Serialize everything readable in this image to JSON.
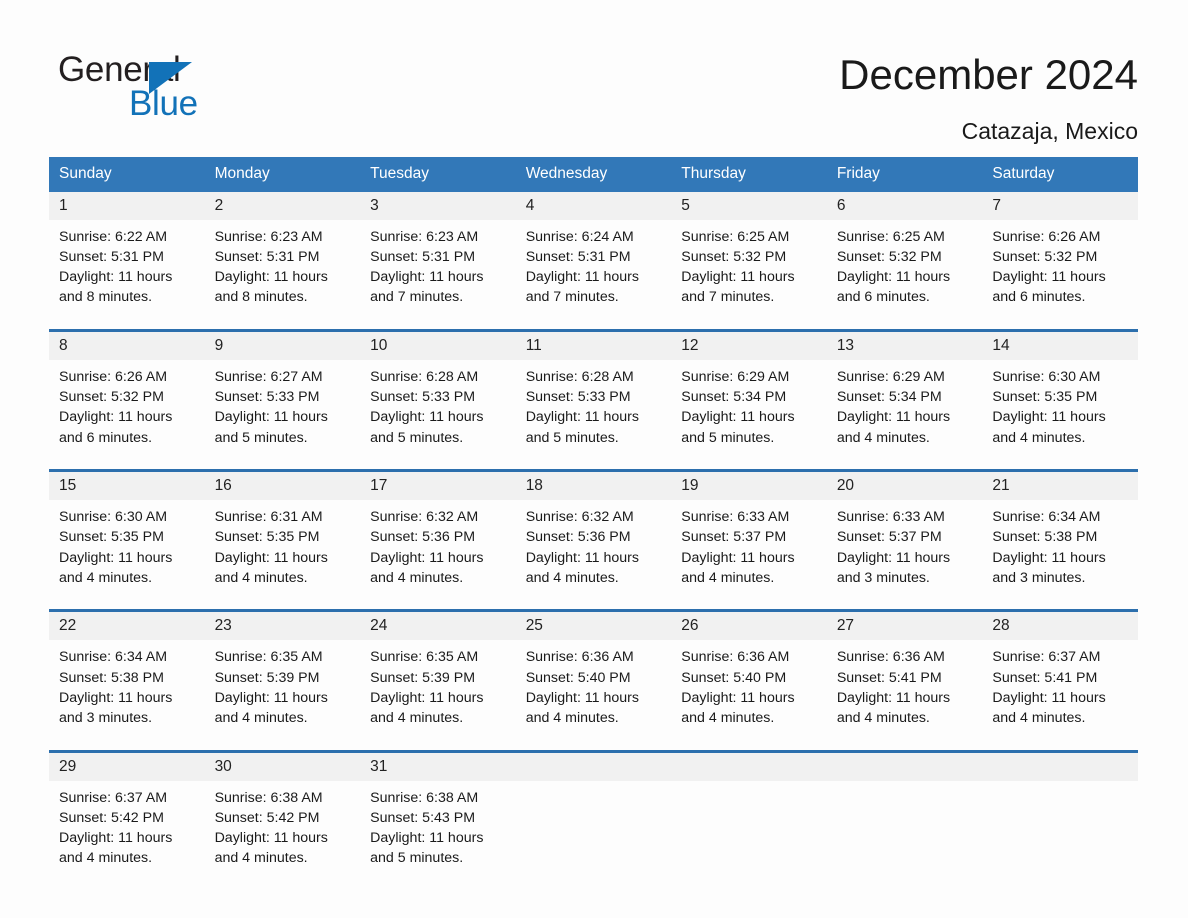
{
  "brand": {
    "name_part1": "General",
    "name_part2": "Blue",
    "accent_color": "#1272b8"
  },
  "header": {
    "title": "December 2024",
    "location": "Catazaja, Mexico"
  },
  "theme": {
    "header_blue": "#3278b8",
    "divider_blue": "#2c6fad",
    "daynum_bg": "#f1f1f1",
    "page_bg": "#fdfdfd"
  },
  "weekdays": [
    "Sunday",
    "Monday",
    "Tuesday",
    "Wednesday",
    "Thursday",
    "Friday",
    "Saturday"
  ],
  "weeks": [
    {
      "days": [
        {
          "date": "1",
          "sunrise": "Sunrise: 6:22 AM",
          "sunset": "Sunset: 5:31 PM",
          "daylight1": "Daylight: 11 hours",
          "daylight2": "and 8 minutes."
        },
        {
          "date": "2",
          "sunrise": "Sunrise: 6:23 AM",
          "sunset": "Sunset: 5:31 PM",
          "daylight1": "Daylight: 11 hours",
          "daylight2": "and 8 minutes."
        },
        {
          "date": "3",
          "sunrise": "Sunrise: 6:23 AM",
          "sunset": "Sunset: 5:31 PM",
          "daylight1": "Daylight: 11 hours",
          "daylight2": "and 7 minutes."
        },
        {
          "date": "4",
          "sunrise": "Sunrise: 6:24 AM",
          "sunset": "Sunset: 5:31 PM",
          "daylight1": "Daylight: 11 hours",
          "daylight2": "and 7 minutes."
        },
        {
          "date": "5",
          "sunrise": "Sunrise: 6:25 AM",
          "sunset": "Sunset: 5:32 PM",
          "daylight1": "Daylight: 11 hours",
          "daylight2": "and 7 minutes."
        },
        {
          "date": "6",
          "sunrise": "Sunrise: 6:25 AM",
          "sunset": "Sunset: 5:32 PM",
          "daylight1": "Daylight: 11 hours",
          "daylight2": "and 6 minutes."
        },
        {
          "date": "7",
          "sunrise": "Sunrise: 6:26 AM",
          "sunset": "Sunset: 5:32 PM",
          "daylight1": "Daylight: 11 hours",
          "daylight2": "and 6 minutes."
        }
      ]
    },
    {
      "days": [
        {
          "date": "8",
          "sunrise": "Sunrise: 6:26 AM",
          "sunset": "Sunset: 5:32 PM",
          "daylight1": "Daylight: 11 hours",
          "daylight2": "and 6 minutes."
        },
        {
          "date": "9",
          "sunrise": "Sunrise: 6:27 AM",
          "sunset": "Sunset: 5:33 PM",
          "daylight1": "Daylight: 11 hours",
          "daylight2": "and 5 minutes."
        },
        {
          "date": "10",
          "sunrise": "Sunrise: 6:28 AM",
          "sunset": "Sunset: 5:33 PM",
          "daylight1": "Daylight: 11 hours",
          "daylight2": "and 5 minutes."
        },
        {
          "date": "11",
          "sunrise": "Sunrise: 6:28 AM",
          "sunset": "Sunset: 5:33 PM",
          "daylight1": "Daylight: 11 hours",
          "daylight2": "and 5 minutes."
        },
        {
          "date": "12",
          "sunrise": "Sunrise: 6:29 AM",
          "sunset": "Sunset: 5:34 PM",
          "daylight1": "Daylight: 11 hours",
          "daylight2": "and 5 minutes."
        },
        {
          "date": "13",
          "sunrise": "Sunrise: 6:29 AM",
          "sunset": "Sunset: 5:34 PM",
          "daylight1": "Daylight: 11 hours",
          "daylight2": "and 4 minutes."
        },
        {
          "date": "14",
          "sunrise": "Sunrise: 6:30 AM",
          "sunset": "Sunset: 5:35 PM",
          "daylight1": "Daylight: 11 hours",
          "daylight2": "and 4 minutes."
        }
      ]
    },
    {
      "days": [
        {
          "date": "15",
          "sunrise": "Sunrise: 6:30 AM",
          "sunset": "Sunset: 5:35 PM",
          "daylight1": "Daylight: 11 hours",
          "daylight2": "and 4 minutes."
        },
        {
          "date": "16",
          "sunrise": "Sunrise: 6:31 AM",
          "sunset": "Sunset: 5:35 PM",
          "daylight1": "Daylight: 11 hours",
          "daylight2": "and 4 minutes."
        },
        {
          "date": "17",
          "sunrise": "Sunrise: 6:32 AM",
          "sunset": "Sunset: 5:36 PM",
          "daylight1": "Daylight: 11 hours",
          "daylight2": "and 4 minutes."
        },
        {
          "date": "18",
          "sunrise": "Sunrise: 6:32 AM",
          "sunset": "Sunset: 5:36 PM",
          "daylight1": "Daylight: 11 hours",
          "daylight2": "and 4 minutes."
        },
        {
          "date": "19",
          "sunrise": "Sunrise: 6:33 AM",
          "sunset": "Sunset: 5:37 PM",
          "daylight1": "Daylight: 11 hours",
          "daylight2": "and 4 minutes."
        },
        {
          "date": "20",
          "sunrise": "Sunrise: 6:33 AM",
          "sunset": "Sunset: 5:37 PM",
          "daylight1": "Daylight: 11 hours",
          "daylight2": "and 3 minutes."
        },
        {
          "date": "21",
          "sunrise": "Sunrise: 6:34 AM",
          "sunset": "Sunset: 5:38 PM",
          "daylight1": "Daylight: 11 hours",
          "daylight2": "and 3 minutes."
        }
      ]
    },
    {
      "days": [
        {
          "date": "22",
          "sunrise": "Sunrise: 6:34 AM",
          "sunset": "Sunset: 5:38 PM",
          "daylight1": "Daylight: 11 hours",
          "daylight2": "and 3 minutes."
        },
        {
          "date": "23",
          "sunrise": "Sunrise: 6:35 AM",
          "sunset": "Sunset: 5:39 PM",
          "daylight1": "Daylight: 11 hours",
          "daylight2": "and 4 minutes."
        },
        {
          "date": "24",
          "sunrise": "Sunrise: 6:35 AM",
          "sunset": "Sunset: 5:39 PM",
          "daylight1": "Daylight: 11 hours",
          "daylight2": "and 4 minutes."
        },
        {
          "date": "25",
          "sunrise": "Sunrise: 6:36 AM",
          "sunset": "Sunset: 5:40 PM",
          "daylight1": "Daylight: 11 hours",
          "daylight2": "and 4 minutes."
        },
        {
          "date": "26",
          "sunrise": "Sunrise: 6:36 AM",
          "sunset": "Sunset: 5:40 PM",
          "daylight1": "Daylight: 11 hours",
          "daylight2": "and 4 minutes."
        },
        {
          "date": "27",
          "sunrise": "Sunrise: 6:36 AM",
          "sunset": "Sunset: 5:41 PM",
          "daylight1": "Daylight: 11 hours",
          "daylight2": "and 4 minutes."
        },
        {
          "date": "28",
          "sunrise": "Sunrise: 6:37 AM",
          "sunset": "Sunset: 5:41 PM",
          "daylight1": "Daylight: 11 hours",
          "daylight2": "and 4 minutes."
        }
      ]
    },
    {
      "days": [
        {
          "date": "29",
          "sunrise": "Sunrise: 6:37 AM",
          "sunset": "Sunset: 5:42 PM",
          "daylight1": "Daylight: 11 hours",
          "daylight2": "and 4 minutes."
        },
        {
          "date": "30",
          "sunrise": "Sunrise: 6:38 AM",
          "sunset": "Sunset: 5:42 PM",
          "daylight1": "Daylight: 11 hours",
          "daylight2": "and 4 minutes."
        },
        {
          "date": "31",
          "sunrise": "Sunrise: 6:38 AM",
          "sunset": "Sunset: 5:43 PM",
          "daylight1": "Daylight: 11 hours",
          "daylight2": "and 5 minutes."
        },
        {
          "date": "",
          "sunrise": "",
          "sunset": "",
          "daylight1": "",
          "daylight2": ""
        },
        {
          "date": "",
          "sunrise": "",
          "sunset": "",
          "daylight1": "",
          "daylight2": ""
        },
        {
          "date": "",
          "sunrise": "",
          "sunset": "",
          "daylight1": "",
          "daylight2": ""
        },
        {
          "date": "",
          "sunrise": "",
          "sunset": "",
          "daylight1": "",
          "daylight2": ""
        }
      ]
    }
  ]
}
